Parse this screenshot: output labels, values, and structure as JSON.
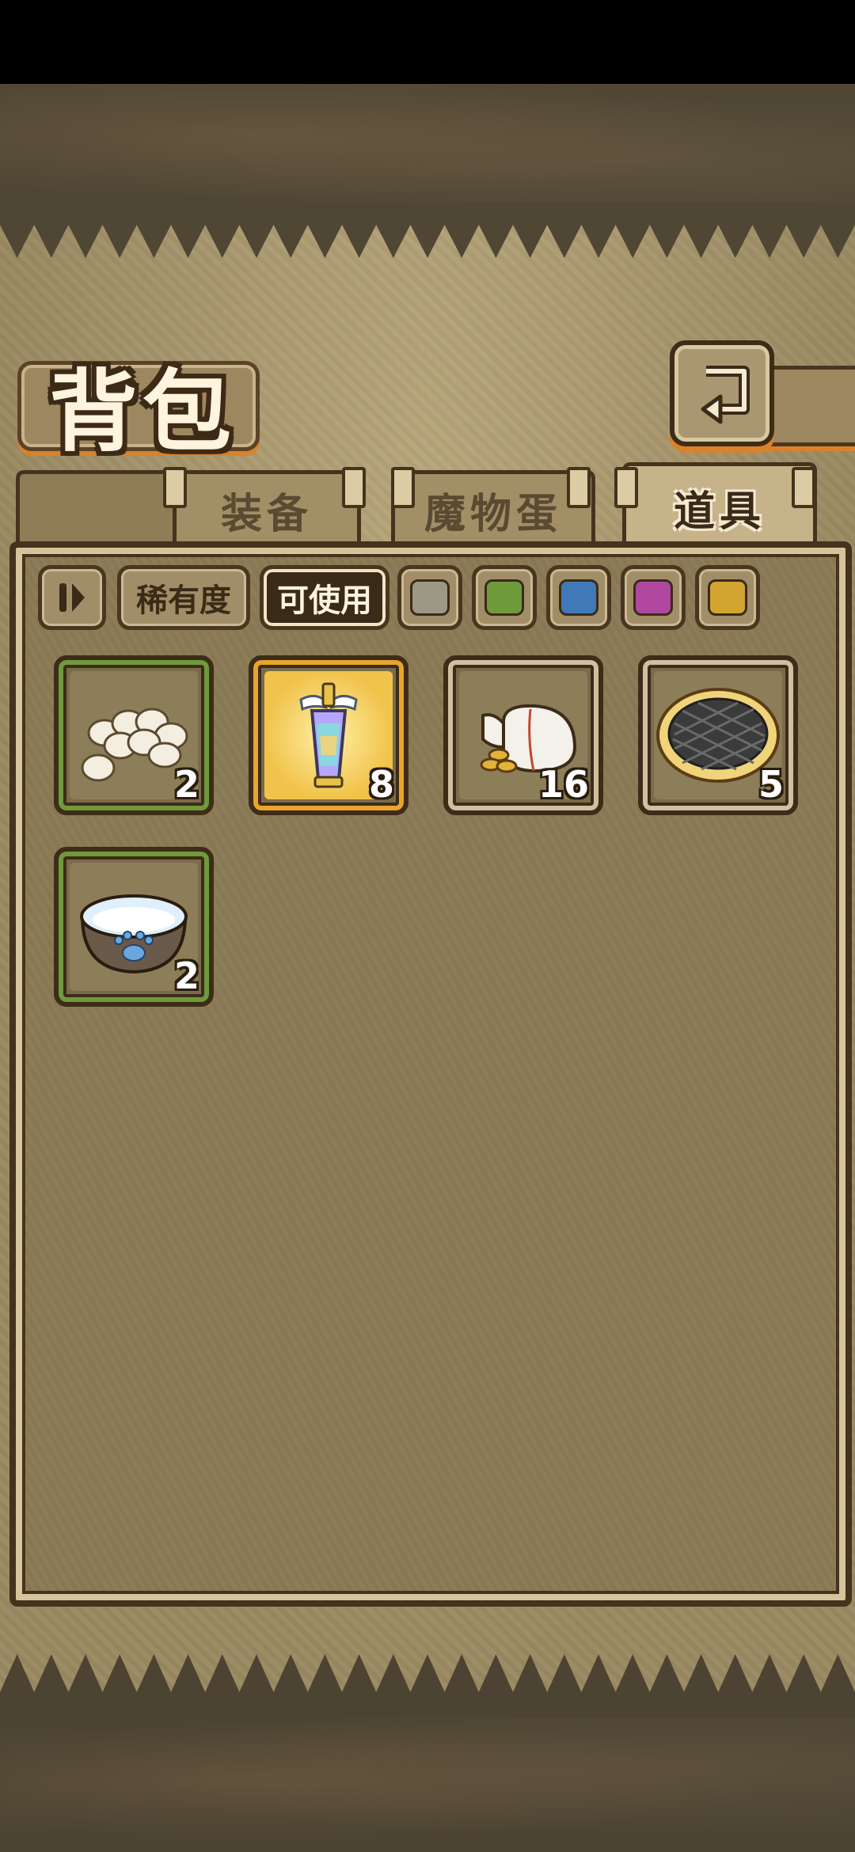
{
  "header": {
    "title": "背包"
  },
  "tabs": [
    {
      "label": "装备",
      "active": false
    },
    {
      "label": "魔物蛋",
      "active": false
    },
    {
      "label": "道具",
      "active": true
    }
  ],
  "filters": {
    "rarity_label": "稀有度",
    "usable_label": "可使用",
    "rarity_colors": [
      "#9d9786",
      "#6f9a3c",
      "#3f79b8",
      "#b048a0",
      "#d2a531"
    ]
  },
  "items": [
    {
      "icon": "eggs-icon",
      "count": "2",
      "rim": "#6f9a3c"
    },
    {
      "icon": "winged-potion-icon",
      "count": "8",
      "rim": "#e8a42c"
    },
    {
      "icon": "coin-sack-icon",
      "count": "16",
      "rim": "#cfc0a0"
    },
    {
      "icon": "grilled-pie-icon",
      "count": "5",
      "rim": "#cfc0a0"
    },
    {
      "icon": "paw-bowl-icon",
      "count": "2",
      "rim": "#6f9a3c"
    }
  ]
}
